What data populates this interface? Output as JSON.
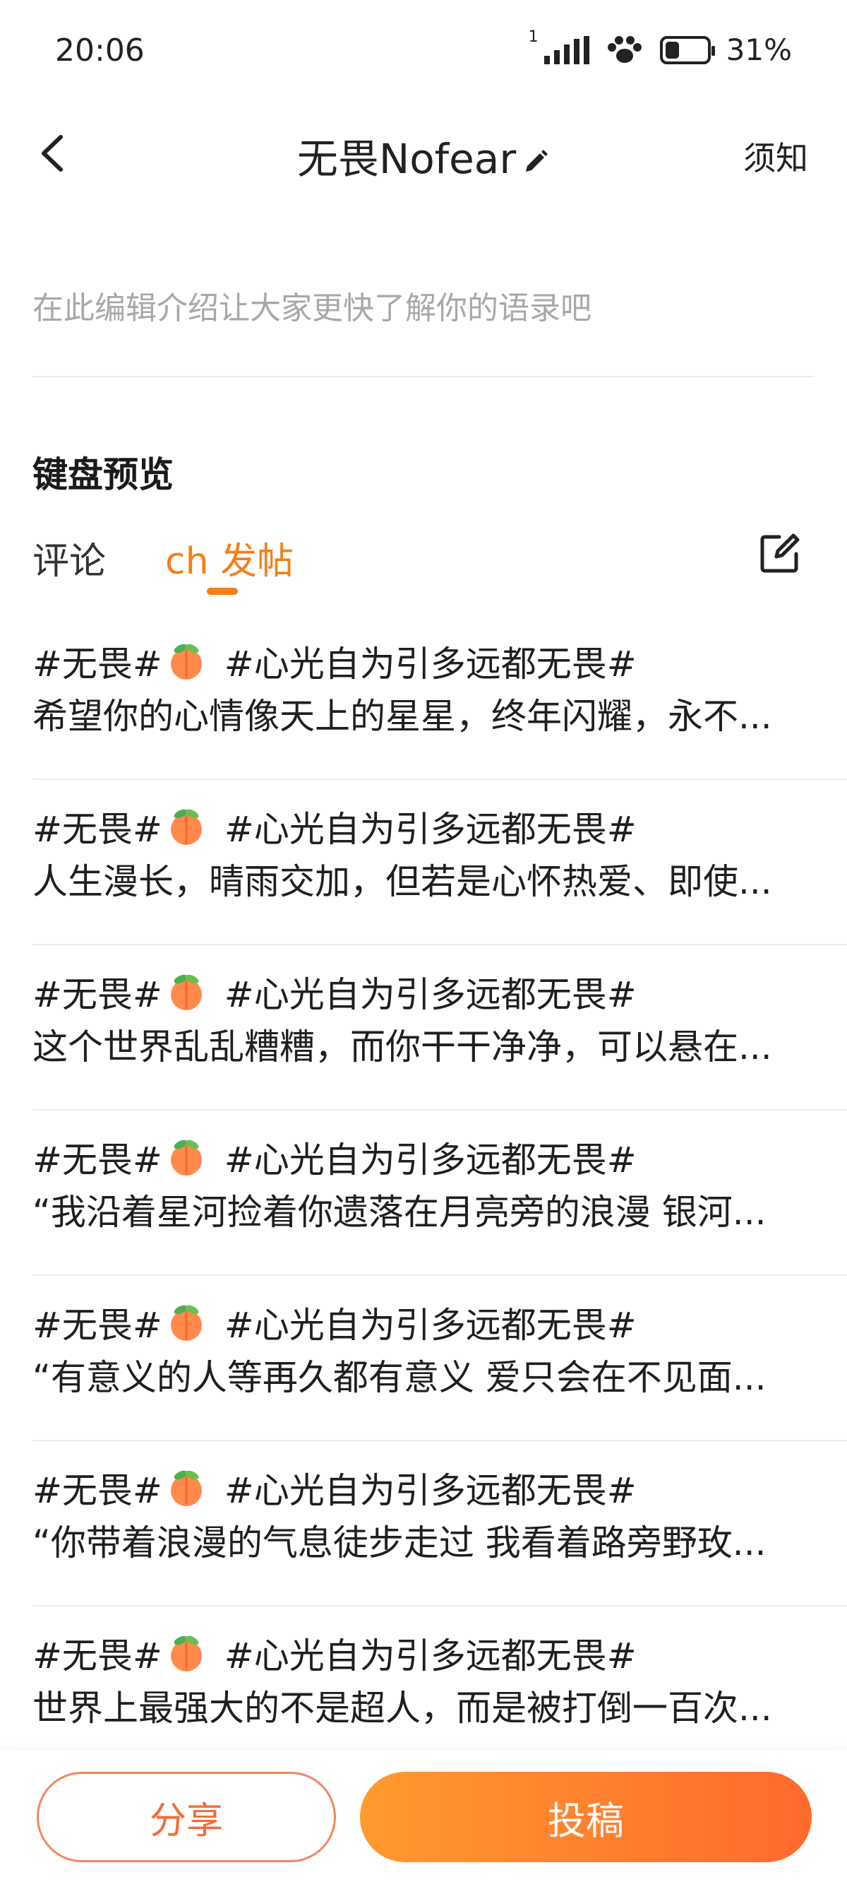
{
  "status_bar": {
    "time": "20:06",
    "sim": "1",
    "battery": "31%",
    "battery_level": 0.31
  },
  "nav": {
    "title": "无畏Nofear",
    "notice_label": "须知"
  },
  "profile": {
    "intro_placeholder": "在此编辑介绍让大家更快了解你的语录吧"
  },
  "section": {
    "title": "键盘预览"
  },
  "tabs": [
    {
      "label": "评论",
      "active": false
    },
    {
      "label": "ch 发帖",
      "active": true
    }
  ],
  "posts": [
    {
      "tag1": "#无畏#",
      "tag2": "#心光自为引多远都无畏#",
      "text": "希望你的心情像天上的星星，终年闪耀，永不..."
    },
    {
      "tag1": "#无畏#",
      "tag2": "#心光自为引多远都无畏#",
      "text": "人生漫长，晴雨交加，但若是心怀热爱、即使..."
    },
    {
      "tag1": "#无畏#",
      "tag2": "#心光自为引多远都无畏#",
      "text": "这个世界乱乱糟糟，而你干干净净，可以悬在..."
    },
    {
      "tag1": "#无畏#",
      "tag2": "#心光自为引多远都无畏#",
      "text": "“我沿着星河捡着你遗落在月亮旁的浪漫 银河..."
    },
    {
      "tag1": "#无畏#",
      "tag2": "#心光自为引多远都无畏#",
      "text": " “有意义的人等再久都有意义 爱只会在不见面..."
    },
    {
      "tag1": "#无畏#",
      "tag2": "#心光自为引多远都无畏#",
      "text": "“你带着浪漫的气息徒步走过 我看着路旁野玫..."
    },
    {
      "tag1": "#无畏#",
      "tag2": "#心光自为引多远都无畏#",
      "text": "世界上最强大的不是超人，而是被打倒一百次..."
    }
  ],
  "bottom": {
    "share_label": "分享",
    "submit_label": "投稿"
  },
  "colors": {
    "accent": "#f47f16",
    "share_border": "#f1865f",
    "submit_start": "#ff9a2e",
    "submit_end": "#ff6a2d"
  },
  "icons": [
    "back-icon",
    "pencil-icon",
    "compose-icon",
    "peach-emoji",
    "signal-icon",
    "paw-icon",
    "battery-icon"
  ]
}
